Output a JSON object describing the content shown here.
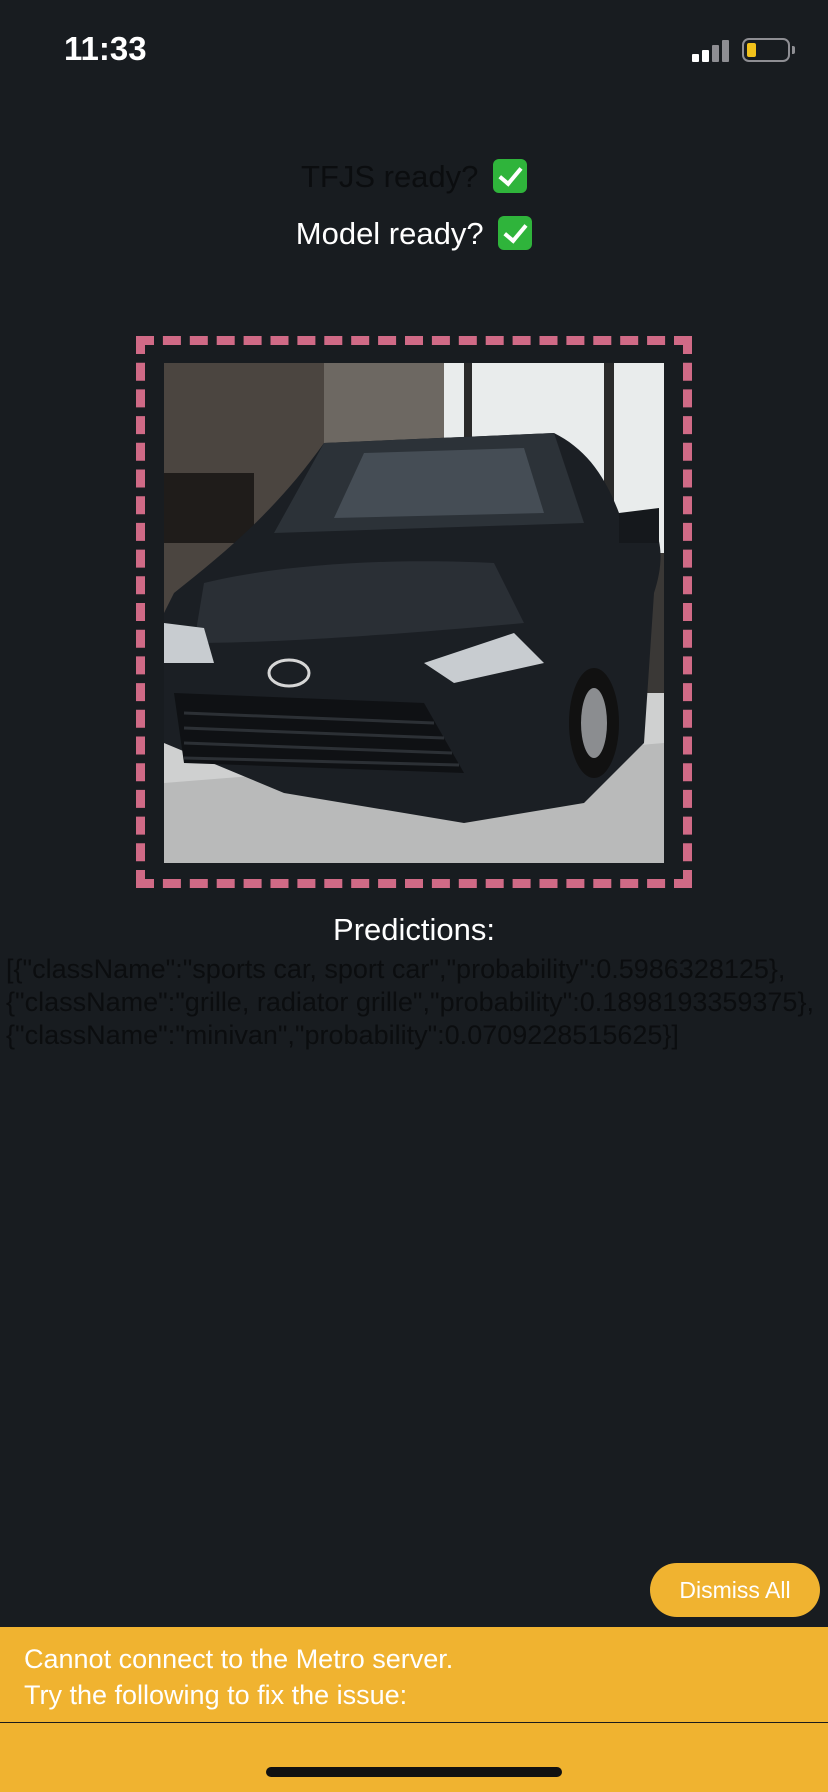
{
  "status_bar": {
    "time": "11:33",
    "signal_icon": "cellular-signal-icon",
    "battery_icon": "battery-low-icon",
    "battery_color": "#f2c21b"
  },
  "status": {
    "tfjs_label": "TFJS ready?",
    "model_label": "Model ready?",
    "check_icon": "check-mark-icon",
    "check_color": "#2fb43b"
  },
  "image_frame": {
    "border_color": "#d06a86",
    "image_description_icon": "car-photo"
  },
  "predictions": {
    "title": "Predictions:",
    "json_text": "[{\"className\":\"sports car, sport car\",\"probability\":0.5986328125},{\"className\":\"grille, radiator grille\",\"probability\":0.1898193359375},{\"className\":\"minivan\",\"probability\":0.0709228515625}]"
  },
  "dismiss_button": {
    "label": "Dismiss All",
    "color": "#f0b330"
  },
  "error_banner": {
    "line1": "Cannot connect to the Metro server.",
    "line2": "Try the following to fix the issue:",
    "color": "#f0b330"
  }
}
